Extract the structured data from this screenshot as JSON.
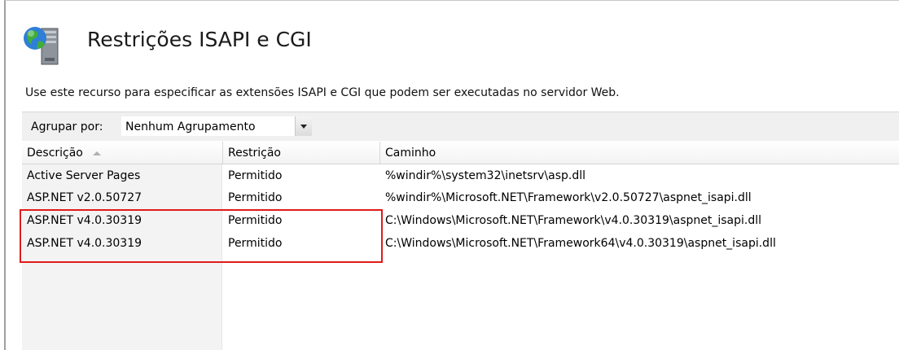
{
  "page": {
    "title": "Restrições ISAPI e CGI",
    "description": "Use este recurso para especificar as extensões ISAPI e CGI que podem ser executadas no servidor Web."
  },
  "toolbar": {
    "group_label": "Agrupar por:",
    "group_value": "Nenhum Agrupamento"
  },
  "table": {
    "columns": [
      "Descrição",
      "Restrição",
      "Caminho"
    ],
    "sorted_column": "Descrição",
    "rows": [
      {
        "descricao": "Active Server Pages",
        "restricao": "Permitido",
        "caminho": "%windir%\\system32\\inetsrv\\asp.dll"
      },
      {
        "descricao": "ASP.NET v2.0.50727",
        "restricao": "Permitido",
        "caminho": "%windir%\\Microsoft.NET\\Framework\\v2.0.50727\\aspnet_isapi.dll"
      },
      {
        "descricao": "ASP.NET v4.0.30319",
        "restricao": "Permitido",
        "caminho": "C:\\Windows\\Microsoft.NET\\Framework\\v4.0.30319\\aspnet_isapi.dll"
      },
      {
        "descricao": "ASP.NET v4.0.30319",
        "restricao": "Permitido",
        "caminho": "C:\\Windows\\Microsoft.NET\\Framework64\\v4.0.30319\\aspnet_isapi.dll"
      }
    ]
  },
  "annotation": {
    "highlight_color": "#e01b1b"
  },
  "icons": {
    "feature": "globe-server-icon",
    "dropdown": "chevron-down-icon",
    "sort": "sort-ascending-icon"
  }
}
